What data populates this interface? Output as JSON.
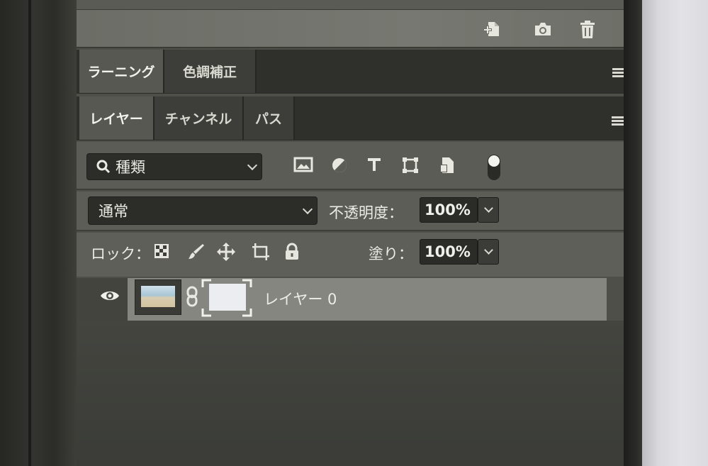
{
  "toolbar_icons": [
    "new-layer-icon",
    "camera-icon",
    "trash-icon"
  ],
  "panel_top": {
    "tabs": [
      {
        "label": "ラーニング",
        "active": true
      },
      {
        "label": "色調補正",
        "active": false
      }
    ]
  },
  "layers_panel": {
    "tabs": [
      {
        "label": "レイヤー",
        "active": true
      },
      {
        "label": "チャンネル",
        "active": false
      },
      {
        "label": "パス",
        "active": false
      }
    ],
    "filter": {
      "label": "種類",
      "icons": [
        "image-filter-icon",
        "adjustment-filter-icon",
        "type-filter-icon",
        "shape-filter-icon",
        "smart-object-filter-icon",
        "filter-toggle-icon"
      ]
    },
    "blend_mode": "通常",
    "opacity_label": "不透明度：",
    "opacity_value": "100%",
    "lock_label": "ロック：",
    "lock_icons": [
      "lock-transparent-pixels-icon",
      "lock-image-pixels-icon",
      "lock-position-icon",
      "lock-artboard-icon",
      "lock-all-icon"
    ],
    "fill_label": "塗り：",
    "fill_value": "100%",
    "layers": [
      {
        "name": "レイヤー 0",
        "visible": true,
        "has_mask": true
      }
    ]
  },
  "colors": {
    "panel_bg": "#4e4f49",
    "tab_active": "#575852",
    "selected_layer": "#858680"
  }
}
